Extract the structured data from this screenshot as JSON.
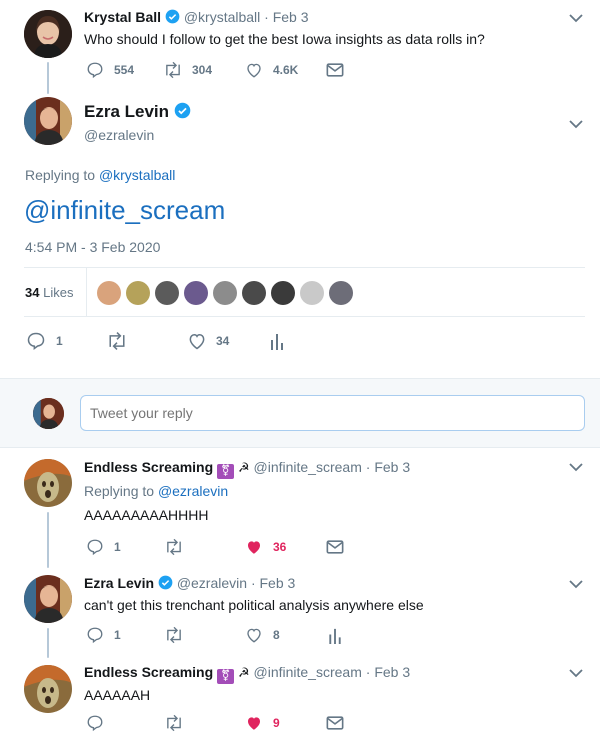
{
  "tweet1": {
    "name": "Krystal Ball",
    "handle": "@krystalball",
    "date": "· Feb 3",
    "text": "Who should I follow to get the best Iowa insights as data rolls in?",
    "replies": "554",
    "retweets": "304",
    "likes": "4.6K"
  },
  "main": {
    "name": "Ezra Levin",
    "handle": "@ezralevin",
    "replying_label": "Replying to",
    "replying_handle": "@krystalball",
    "text": "@infinite_scream",
    "timestamp": "4:54 PM - 3 Feb 2020",
    "likes_count": "34",
    "likes_label": "Likes",
    "replies": "1",
    "like_count": "34"
  },
  "compose": {
    "placeholder": "Tweet your reply"
  },
  "reply1": {
    "name": "Endless Screaming",
    "handle": "@infinite_scream",
    "date": "· Feb 3",
    "replying_label": "Replying to",
    "replying_handle": "@ezralevin",
    "text": "AAAAAAAAAHHHH",
    "replies": "1",
    "likes": "36"
  },
  "reply2": {
    "name": "Ezra Levin",
    "handle": "@ezralevin",
    "date": "· Feb 3",
    "text": "can't get this trenchant political analysis anywhere else",
    "replies": "1",
    "likes": "8"
  },
  "reply3": {
    "name": "Endless Screaming",
    "handle": "@infinite_scream",
    "date": "· Feb 3",
    "text": "AAAAAAH",
    "likes": "9"
  },
  "colors": {
    "link": "#1b6fbf",
    "muted": "#657786",
    "liked": "#e0245e",
    "verified": "#1da1f2",
    "divider": "#e6ecf0"
  }
}
